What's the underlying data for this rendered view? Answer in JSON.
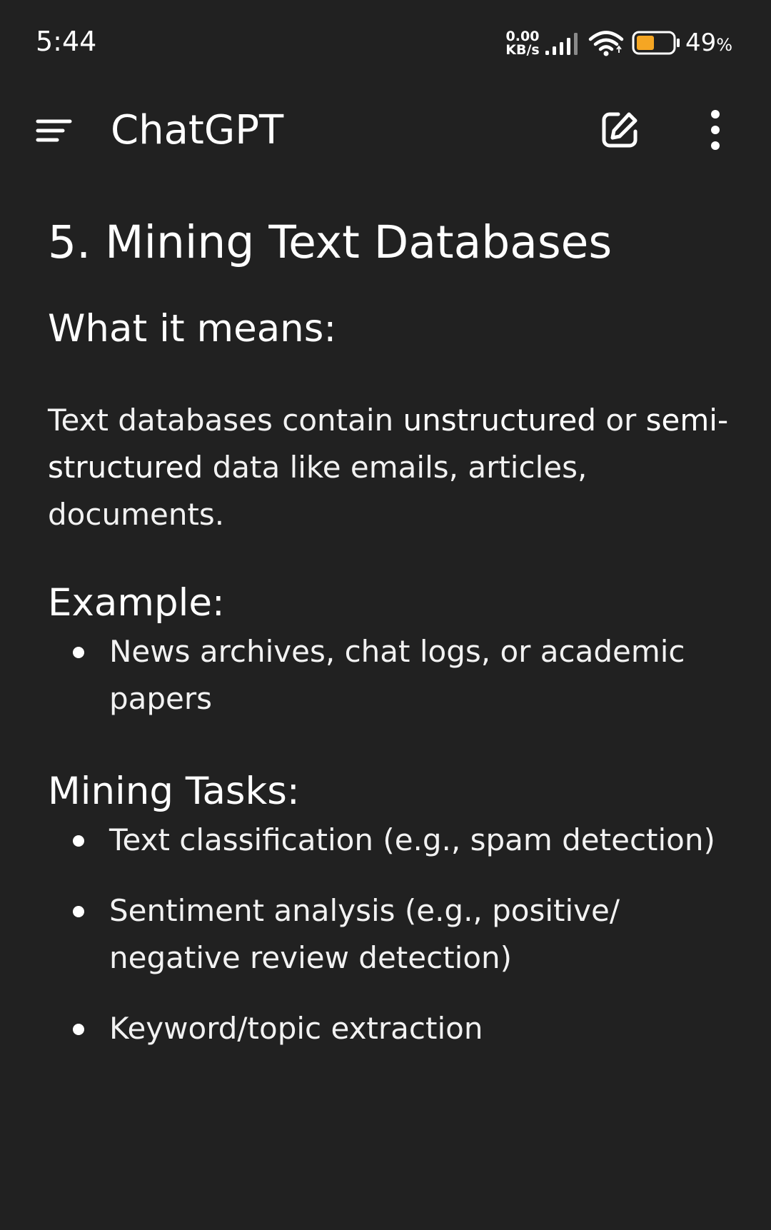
{
  "status_bar": {
    "time": "5:44",
    "net_speed_value": "0.00",
    "net_speed_unit": "KB/s",
    "battery_percent": "49",
    "battery_percent_sign": "%",
    "battery_level": 0.49,
    "battery_fill_color": "#f5a623",
    "icons": [
      "signal-icon",
      "wifi-icon",
      "battery-icon"
    ]
  },
  "app_bar": {
    "title": "ChatGPT",
    "icons": [
      "menu-icon",
      "compose-icon",
      "more-vertical-icon"
    ]
  },
  "content": {
    "title": "5. Mining Text Databases",
    "what_heading": "What it means:",
    "what_text": {
      "part1": "Text databases contain ",
      "bold1": "unstructured",
      "part2": " or ",
      "bold2": "semi-structured",
      "part3": " data like emails, articles, documents."
    },
    "example_heading": "Example:",
    "example_items": [
      "News archives, chat logs, or academic papers"
    ],
    "tasks_heading": "Mining Tasks:",
    "task_items": [
      "Text classification (e.g., spam detection)",
      "Sentiment analysis (e.g., positive/ negative review detection)",
      "Keyword/topic extraction"
    ]
  },
  "colors": {
    "background": "#212121",
    "text": "#ffffff"
  }
}
